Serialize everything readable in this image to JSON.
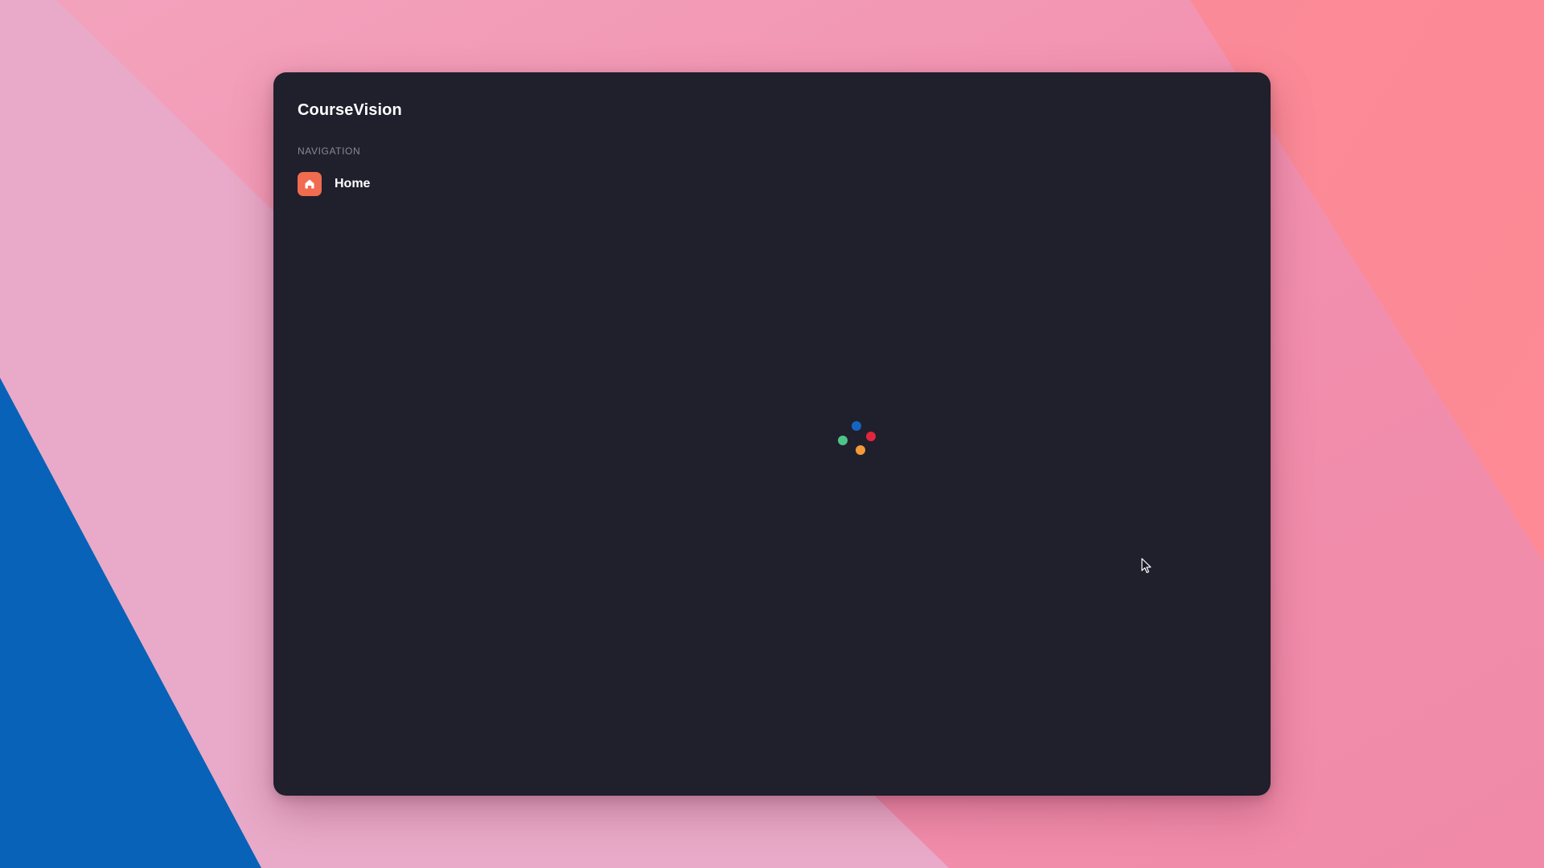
{
  "app": {
    "title": "CourseVision"
  },
  "sidebar": {
    "heading": "NAVIGATION",
    "items": [
      {
        "label": "Home",
        "icon": "home-icon",
        "active": true
      }
    ]
  },
  "loading": {
    "indicator": "loading-spinner",
    "dot_colors": [
      "#1565c0",
      "#e0263d",
      "#f29a3a",
      "#4cc489"
    ]
  },
  "colors": {
    "window_bg": "#201f2c",
    "accent": "#f06b4f",
    "muted_text": "#8a8898",
    "wallpaper_pink": "#f49ab6",
    "wallpaper_blue": "#0762b8"
  }
}
